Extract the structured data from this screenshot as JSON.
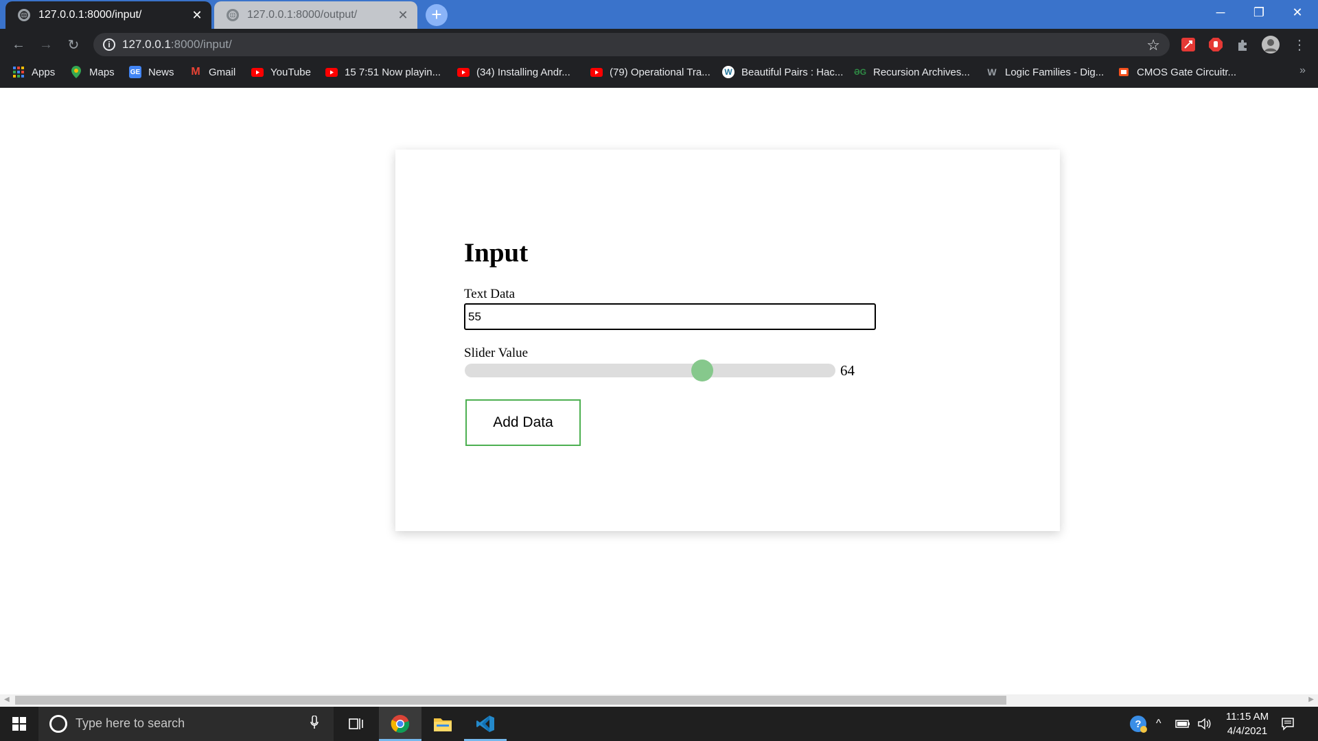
{
  "browser": {
    "tabs": [
      {
        "title": "127.0.0.1:8000/input/",
        "active": true
      },
      {
        "title": "127.0.0.1:8000/output/",
        "active": false
      }
    ],
    "new_tab": "+",
    "window_controls": {
      "minimize": "─",
      "restore": "❐",
      "close": "✕"
    },
    "address": {
      "host": "127.0.0.1",
      "path": ":8000/input/"
    },
    "bookmarks": [
      {
        "label": "Apps",
        "icon": "apps-grid-icon"
      },
      {
        "label": "Maps",
        "icon": "maps-pin-icon"
      },
      {
        "label": "News",
        "icon": "google-news-icon"
      },
      {
        "label": "Gmail",
        "icon": "gmail-icon"
      },
      {
        "label": "YouTube",
        "icon": "youtube-icon"
      },
      {
        "label": "15 7:51 Now playin...",
        "icon": "youtube-icon"
      },
      {
        "label": "(34) Installing Andr...",
        "icon": "youtube-icon"
      },
      {
        "label": "(79) Operational Tra...",
        "icon": "youtube-icon"
      },
      {
        "label": "Beautiful Pairs : Hac...",
        "icon": "wordpress-icon"
      },
      {
        "label": "Recursion Archives...",
        "icon": "geeksforgeeks-icon"
      },
      {
        "label": "Logic Families - Dig...",
        "icon": "w-logo-icon"
      },
      {
        "label": "CMOS Gate Circuitr...",
        "icon": "chip-icon"
      }
    ],
    "bookmarks_more": "»"
  },
  "page": {
    "heading": "Input",
    "text_label": "Text Data",
    "text_value": "55",
    "slider_label": "Slider Value",
    "slider_value": "64",
    "slider_fraction": 0.64,
    "button_label": "Add Data"
  },
  "colors": {
    "tab_strip": "#3a73cb",
    "slider_thumb": "#86c88c",
    "button_border": "#4caf50"
  },
  "taskbar": {
    "search_placeholder": "Type here to search",
    "time": "11:15 AM",
    "date": "4/4/2021"
  }
}
